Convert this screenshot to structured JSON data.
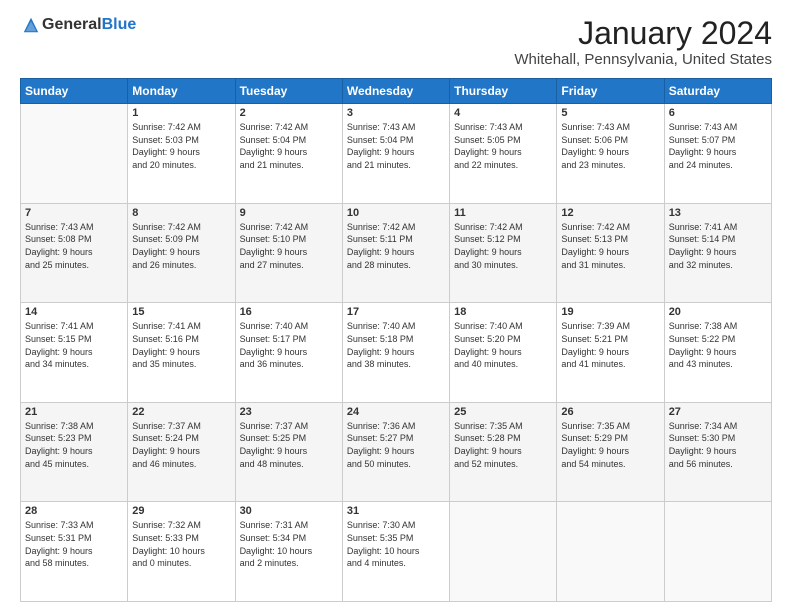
{
  "header": {
    "logo_general": "General",
    "logo_blue": "Blue",
    "month_title": "January 2024",
    "location": "Whitehall, Pennsylvania, United States"
  },
  "weekdays": [
    "Sunday",
    "Monday",
    "Tuesday",
    "Wednesday",
    "Thursday",
    "Friday",
    "Saturday"
  ],
  "weeks": [
    [
      {
        "day": "",
        "info": ""
      },
      {
        "day": "1",
        "info": "Sunrise: 7:42 AM\nSunset: 5:03 PM\nDaylight: 9 hours\nand 20 minutes."
      },
      {
        "day": "2",
        "info": "Sunrise: 7:42 AM\nSunset: 5:04 PM\nDaylight: 9 hours\nand 21 minutes."
      },
      {
        "day": "3",
        "info": "Sunrise: 7:43 AM\nSunset: 5:04 PM\nDaylight: 9 hours\nand 21 minutes."
      },
      {
        "day": "4",
        "info": "Sunrise: 7:43 AM\nSunset: 5:05 PM\nDaylight: 9 hours\nand 22 minutes."
      },
      {
        "day": "5",
        "info": "Sunrise: 7:43 AM\nSunset: 5:06 PM\nDaylight: 9 hours\nand 23 minutes."
      },
      {
        "day": "6",
        "info": "Sunrise: 7:43 AM\nSunset: 5:07 PM\nDaylight: 9 hours\nand 24 minutes."
      }
    ],
    [
      {
        "day": "7",
        "info": "Sunrise: 7:43 AM\nSunset: 5:08 PM\nDaylight: 9 hours\nand 25 minutes."
      },
      {
        "day": "8",
        "info": "Sunrise: 7:42 AM\nSunset: 5:09 PM\nDaylight: 9 hours\nand 26 minutes."
      },
      {
        "day": "9",
        "info": "Sunrise: 7:42 AM\nSunset: 5:10 PM\nDaylight: 9 hours\nand 27 minutes."
      },
      {
        "day": "10",
        "info": "Sunrise: 7:42 AM\nSunset: 5:11 PM\nDaylight: 9 hours\nand 28 minutes."
      },
      {
        "day": "11",
        "info": "Sunrise: 7:42 AM\nSunset: 5:12 PM\nDaylight: 9 hours\nand 30 minutes."
      },
      {
        "day": "12",
        "info": "Sunrise: 7:42 AM\nSunset: 5:13 PM\nDaylight: 9 hours\nand 31 minutes."
      },
      {
        "day": "13",
        "info": "Sunrise: 7:41 AM\nSunset: 5:14 PM\nDaylight: 9 hours\nand 32 minutes."
      }
    ],
    [
      {
        "day": "14",
        "info": "Sunrise: 7:41 AM\nSunset: 5:15 PM\nDaylight: 9 hours\nand 34 minutes."
      },
      {
        "day": "15",
        "info": "Sunrise: 7:41 AM\nSunset: 5:16 PM\nDaylight: 9 hours\nand 35 minutes."
      },
      {
        "day": "16",
        "info": "Sunrise: 7:40 AM\nSunset: 5:17 PM\nDaylight: 9 hours\nand 36 minutes."
      },
      {
        "day": "17",
        "info": "Sunrise: 7:40 AM\nSunset: 5:18 PM\nDaylight: 9 hours\nand 38 minutes."
      },
      {
        "day": "18",
        "info": "Sunrise: 7:40 AM\nSunset: 5:20 PM\nDaylight: 9 hours\nand 40 minutes."
      },
      {
        "day": "19",
        "info": "Sunrise: 7:39 AM\nSunset: 5:21 PM\nDaylight: 9 hours\nand 41 minutes."
      },
      {
        "day": "20",
        "info": "Sunrise: 7:38 AM\nSunset: 5:22 PM\nDaylight: 9 hours\nand 43 minutes."
      }
    ],
    [
      {
        "day": "21",
        "info": "Sunrise: 7:38 AM\nSunset: 5:23 PM\nDaylight: 9 hours\nand 45 minutes."
      },
      {
        "day": "22",
        "info": "Sunrise: 7:37 AM\nSunset: 5:24 PM\nDaylight: 9 hours\nand 46 minutes."
      },
      {
        "day": "23",
        "info": "Sunrise: 7:37 AM\nSunset: 5:25 PM\nDaylight: 9 hours\nand 48 minutes."
      },
      {
        "day": "24",
        "info": "Sunrise: 7:36 AM\nSunset: 5:27 PM\nDaylight: 9 hours\nand 50 minutes."
      },
      {
        "day": "25",
        "info": "Sunrise: 7:35 AM\nSunset: 5:28 PM\nDaylight: 9 hours\nand 52 minutes."
      },
      {
        "day": "26",
        "info": "Sunrise: 7:35 AM\nSunset: 5:29 PM\nDaylight: 9 hours\nand 54 minutes."
      },
      {
        "day": "27",
        "info": "Sunrise: 7:34 AM\nSunset: 5:30 PM\nDaylight: 9 hours\nand 56 minutes."
      }
    ],
    [
      {
        "day": "28",
        "info": "Sunrise: 7:33 AM\nSunset: 5:31 PM\nDaylight: 9 hours\nand 58 minutes."
      },
      {
        "day": "29",
        "info": "Sunrise: 7:32 AM\nSunset: 5:33 PM\nDaylight: 10 hours\nand 0 minutes."
      },
      {
        "day": "30",
        "info": "Sunrise: 7:31 AM\nSunset: 5:34 PM\nDaylight: 10 hours\nand 2 minutes."
      },
      {
        "day": "31",
        "info": "Sunrise: 7:30 AM\nSunset: 5:35 PM\nDaylight: 10 hours\nand 4 minutes."
      },
      {
        "day": "",
        "info": ""
      },
      {
        "day": "",
        "info": ""
      },
      {
        "day": "",
        "info": ""
      }
    ]
  ]
}
